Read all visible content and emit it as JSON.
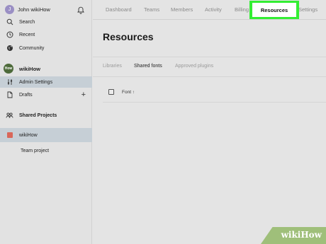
{
  "sidebar": {
    "user": {
      "initial": "J",
      "name": "John wikiHow"
    },
    "nav": [
      {
        "label": "Search",
        "icon": "search-icon"
      },
      {
        "label": "Recent",
        "icon": "clock-icon"
      },
      {
        "label": "Community",
        "icon": "globe-icon"
      }
    ],
    "team": {
      "logo_text": "How",
      "name": "wikiHow",
      "items": [
        {
          "label": "Admin Settings",
          "icon": "sliders-icon",
          "active": true
        },
        {
          "label": "Drafts",
          "icon": "file-icon"
        }
      ]
    },
    "shared_projects_label": "Shared Projects",
    "projects": [
      {
        "label": "wikiHow",
        "color": "#d9675a",
        "active": true
      },
      {
        "label": "Team project"
      }
    ]
  },
  "topnav": {
    "tabs": [
      "Dashboard",
      "Teams",
      "Members",
      "Activity",
      "Billing",
      "Resources",
      "Settings"
    ],
    "active_tab": "Resources"
  },
  "main": {
    "title": "Resources",
    "subtabs": [
      "Libraries",
      "Shared fonts",
      "Approved plugins"
    ],
    "active_subtab": "Shared fonts",
    "table": {
      "column_font": "Font ↑"
    }
  },
  "watermark": {
    "text": "wikiHow"
  },
  "colors": {
    "highlight": "#33ee33",
    "active_nav": "#c6cfd6",
    "project_square": "#d9675a"
  }
}
